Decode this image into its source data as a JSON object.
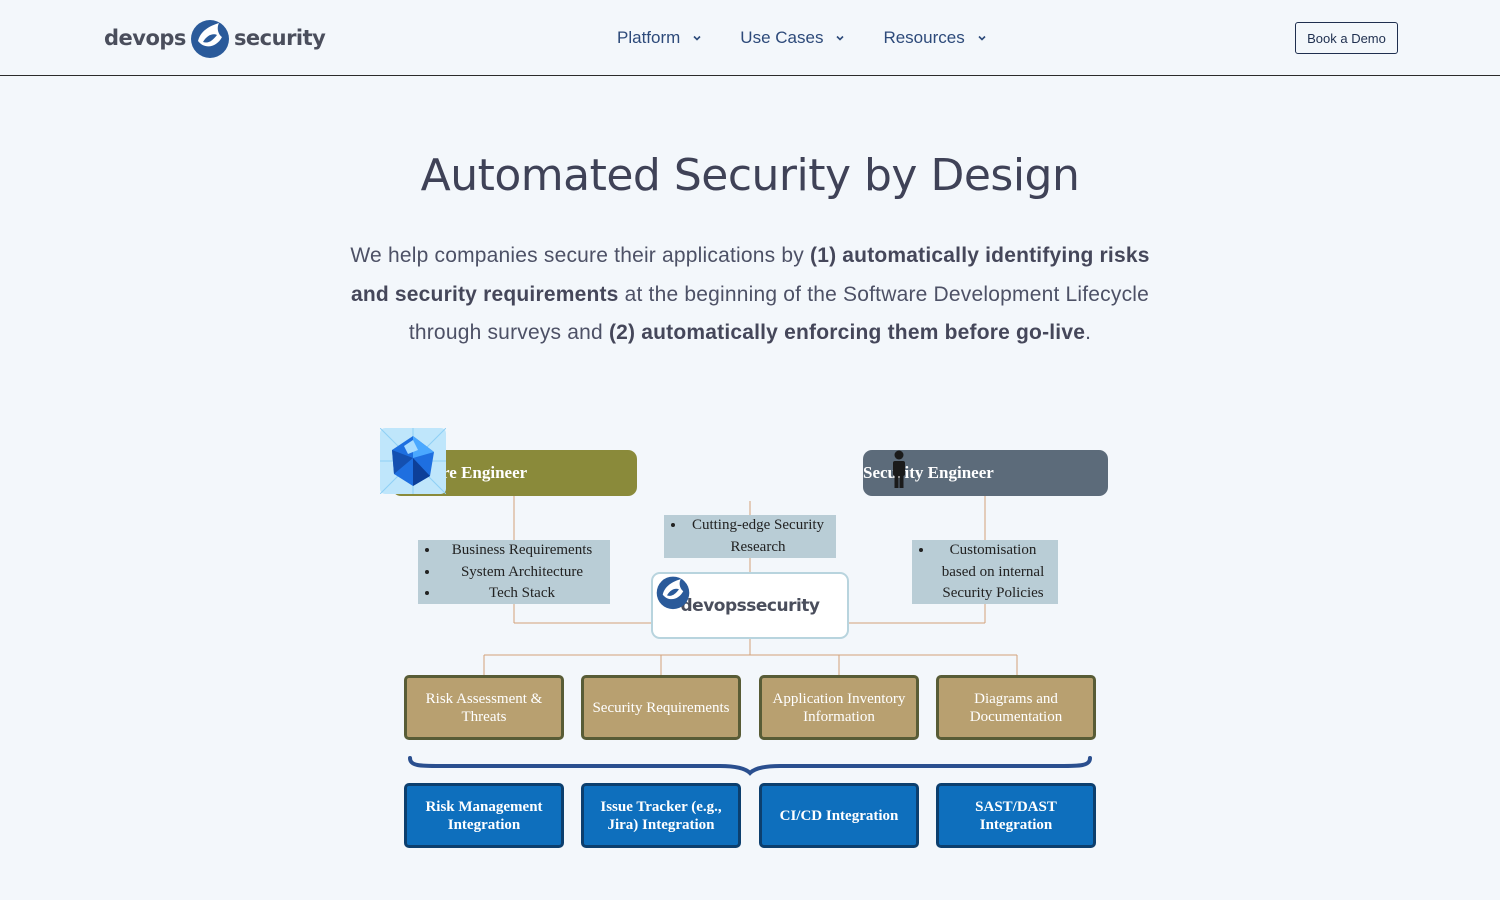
{
  "header": {
    "logo_left": "devops",
    "logo_right": "security",
    "nav": [
      {
        "label": "Platform"
      },
      {
        "label": "Use Cases"
      },
      {
        "label": "Resources"
      }
    ],
    "demo_button": "Book a Demo"
  },
  "hero": {
    "title": "Automated Security by Design",
    "intro": {
      "p1": "We help companies secure their applications by ",
      "b1": "(1) automatically identifying risks and security requirements",
      "p2": " at the beginning of the Software Development Lifecycle through surveys and ",
      "b2": "(2) automatically enforcing them before go-live",
      "p3": "."
    }
  },
  "diagram": {
    "software_engineer": "Software Engineer",
    "security_engineer": "Security Engineer",
    "software_engineer_items": [
      "Business Requirements",
      "System Architecture",
      "Tech Stack"
    ],
    "research_items": [
      "Cutting-edge Security Research"
    ],
    "security_engineer_items": [
      "Customisation based on internal Security Policies"
    ],
    "center_logo_left": "devops",
    "center_logo_right": "security",
    "outputs": [
      "Risk Assessment & Threats",
      "Security Requirements",
      "Application Inventory Information",
      "Diagrams and Documentation"
    ],
    "integrations": [
      "Risk Management Integration",
      "Issue Tracker (e.g., Jira) Integration",
      "CI/CD Integration",
      "SAST/DAST Integration"
    ],
    "colors": {
      "software_engineer": "#8a8a3a",
      "security_engineer": "#5c6b7a",
      "info_box": "#b9cdd6",
      "output_box": "#b8a070",
      "integration_box": "#0e6fbd",
      "brace": "#2a4f8f"
    }
  }
}
